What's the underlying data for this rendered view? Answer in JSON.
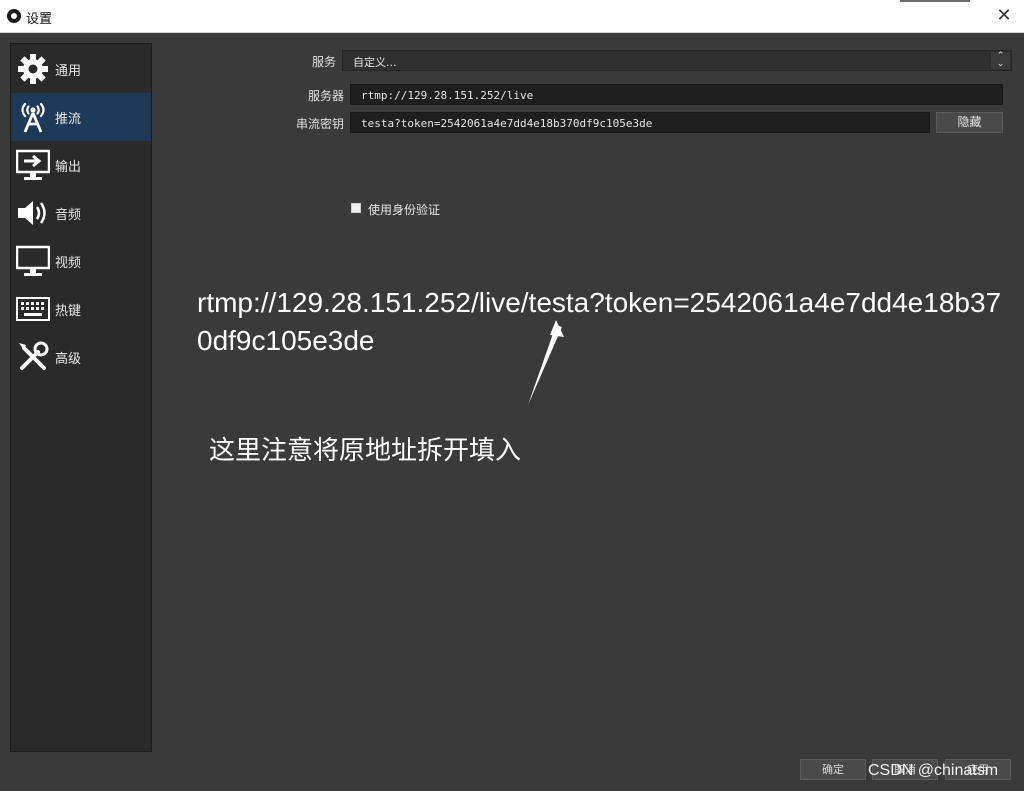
{
  "window": {
    "title": "设置",
    "close_glyph": "✕"
  },
  "sidebar": {
    "items": [
      {
        "label": "通用",
        "icon": "gear-icon"
      },
      {
        "label": "推流",
        "icon": "broadcast-tower-icon",
        "active": true
      },
      {
        "label": "输出",
        "icon": "output-monitor-icon"
      },
      {
        "label": "音频",
        "icon": "speaker-icon"
      },
      {
        "label": "视频",
        "icon": "monitor-icon"
      },
      {
        "label": "热键",
        "icon": "keyboard-icon"
      },
      {
        "label": "高级",
        "icon": "tools-icon"
      }
    ]
  },
  "form": {
    "service_label": "服务",
    "service_value": "自定义...",
    "server_label": "服务器",
    "server_value": "rtmp://129.28.151.252/live",
    "stream_key_label": "串流密钥",
    "stream_key_value": "testa?token=2542061a4e7dd4e18b370df9c105e3de",
    "hide_button": "隐藏",
    "auth_checkbox_label": "使用身份验证"
  },
  "annotation": {
    "url_text": "rtmp://129.28.151.252/live/testa?token=2542061a4e7dd4e18b370df9c105e3de",
    "note": "这里注意将原地址拆开填入"
  },
  "footer": {
    "ok_button": "确定",
    "cancel_button": "取消",
    "apply_button": "应用"
  },
  "watermark": "CSDN @chinatsm",
  "colors": {
    "background": "#3a3a3a",
    "sidebar": "#2a2a2a",
    "active_item": "#1f3a57",
    "field": "#1f1f1f"
  }
}
